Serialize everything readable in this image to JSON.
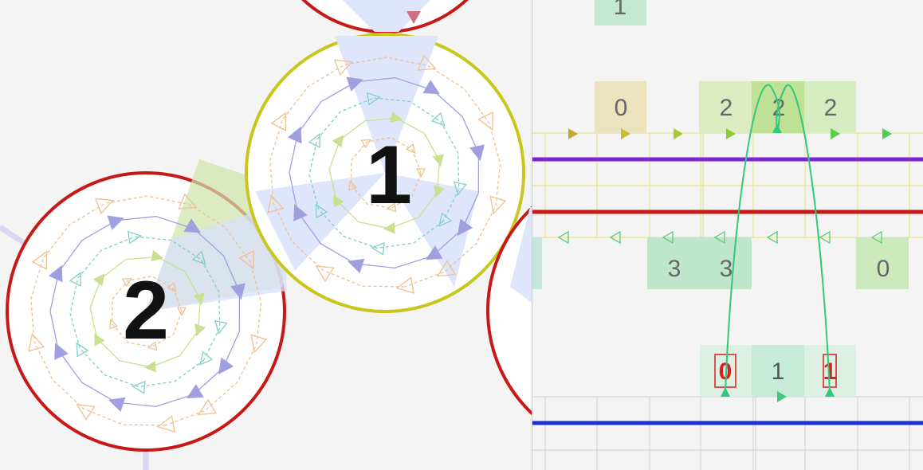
{
  "nodes": [
    {
      "id": "node-1",
      "label": "1",
      "ring_color": "#c9c61e"
    },
    {
      "id": "node-2",
      "label": "2",
      "ring_color": "#c81818"
    },
    {
      "id": "node-top",
      "label": "",
      "ring_color": "#c81818"
    },
    {
      "id": "node-right",
      "label": "",
      "ring_color": "#c81818"
    }
  ],
  "grid": {
    "top_row": [
      {
        "label": "1",
        "color": "#8fd6b2"
      }
    ],
    "row_a": [
      {
        "label": "0",
        "color": "#e5dba0"
      },
      {
        "label": "2",
        "color": "#cde2a2"
      },
      {
        "label": "2",
        "color": "#b9dd82"
      },
      {
        "label": "2",
        "color": "#cde8ad"
      }
    ],
    "row_b": [
      {
        "label": "3",
        "color": "#aee0bf"
      },
      {
        "label": "3",
        "color": "#aee0bf"
      },
      {
        "label": "0",
        "color": "#c2e8b0"
      }
    ],
    "row_c": [
      {
        "label": "0",
        "color": "#e21b1b",
        "boxed": true
      },
      {
        "label": "1",
        "color": "#555555",
        "boxed": false
      },
      {
        "label": "1",
        "color": "#e21b1b",
        "boxed": true
      }
    ]
  },
  "lines": {
    "purple": "#7a25d4",
    "red": "#c81818",
    "blue": "#1d2fd0",
    "arc": "#2ec97a"
  }
}
